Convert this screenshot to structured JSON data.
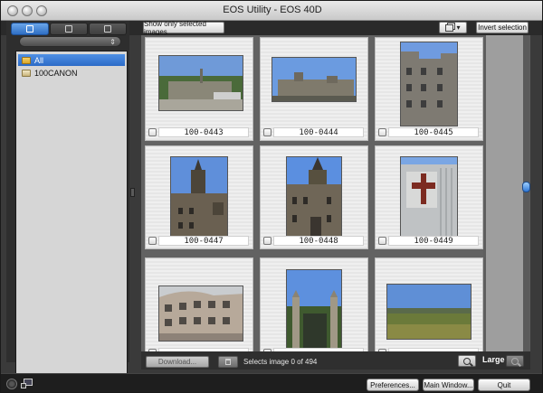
{
  "window": {
    "title": "EOS Utility - EOS 40D"
  },
  "sidebar": {
    "folder_tree": [
      {
        "label": "All",
        "selected": true
      },
      {
        "label": "100CANON",
        "selected": false
      }
    ]
  },
  "toolbar": {
    "show_selected_label": "Show only selected images",
    "invert_selection_label": "Invert selection"
  },
  "images": [
    {
      "name": "100-0443",
      "orientation": "landscape",
      "scene": "castle-hill"
    },
    {
      "name": "100-0444",
      "orientation": "landscape",
      "scene": "old-town-terrace"
    },
    {
      "name": "100-0445",
      "orientation": "portrait",
      "scene": "stone-tenement"
    },
    {
      "name": "100-0447",
      "orientation": "portrait",
      "scene": "spire-building"
    },
    {
      "name": "100-0448",
      "orientation": "portrait",
      "scene": "gothic-tower"
    },
    {
      "name": "100-0449",
      "orientation": "portrait",
      "scene": "cross-facade"
    },
    {
      "name": "",
      "orientation": "landscape",
      "scene": "modern-facade"
    },
    {
      "name": "",
      "orientation": "portrait",
      "scene": "gate-pillars"
    },
    {
      "name": "",
      "orientation": "landscape",
      "scene": "field"
    }
  ],
  "footer": {
    "download_label": "Download...",
    "selection_status": "Selects image 0 of 494",
    "size_label": "Large"
  },
  "window_buttons": {
    "preferences_label": "Preferences...",
    "main_window_label": "Main Window...",
    "quit_label": "Quit"
  }
}
